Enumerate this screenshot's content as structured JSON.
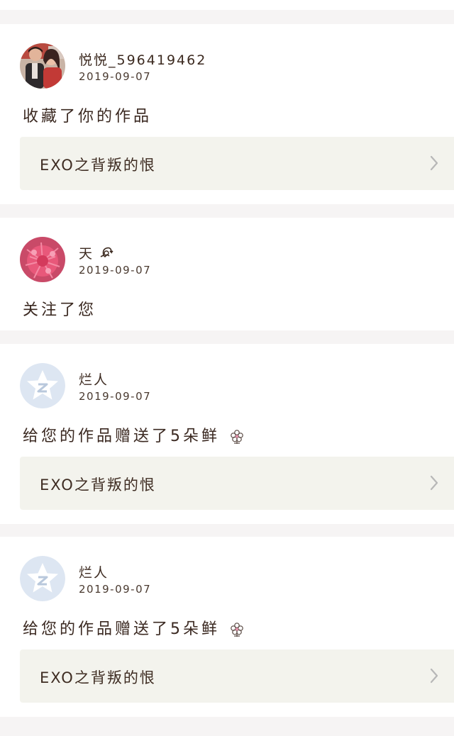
{
  "feed": {
    "items": [
      {
        "user_name": "悦悦_596419462",
        "date": "2019-09-07",
        "activity": "收藏了你的作品",
        "work_title": "EXO之背叛的恨",
        "avatar": "photo-couple"
      },
      {
        "user_name": "天",
        "user_badge": "scorpio-icon",
        "date": "2019-09-07",
        "activity": "关注了您",
        "avatar": "photo-pink-flower"
      },
      {
        "user_name": "烂人",
        "date": "2019-09-07",
        "activity": "给您的作品赠送了5朵鲜",
        "activity_icon": "flower-icon",
        "work_title": "EXO之背叛的恨",
        "avatar": "default-star-avatar"
      },
      {
        "user_name": "烂人",
        "date": "2019-09-07",
        "activity": "给您的作品赠送了5朵鲜",
        "activity_icon": "flower-icon",
        "work_title": "EXO之背叛的恨",
        "avatar": "default-star-avatar"
      }
    ]
  },
  "colors": {
    "page_background": "#f6f4f4",
    "card_background": "#ffffff",
    "work_link_background": "#f3f3ed",
    "default_avatar": "#dde6f2",
    "text": "#3a2a22"
  }
}
